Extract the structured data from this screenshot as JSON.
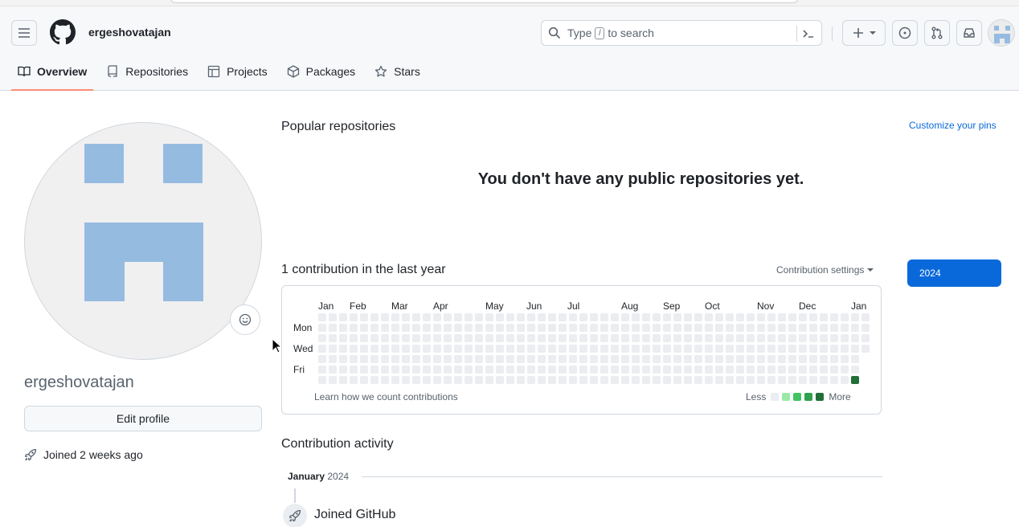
{
  "header": {
    "username": "ergeshovatajan",
    "search_placeholder_before": "Type",
    "search_slash": "/",
    "search_placeholder_after": "to search"
  },
  "tabs": [
    {
      "label": "Overview",
      "icon": "book-icon",
      "active": true
    },
    {
      "label": "Repositories",
      "icon": "repo-icon"
    },
    {
      "label": "Projects",
      "icon": "table-icon"
    },
    {
      "label": "Packages",
      "icon": "package-icon"
    },
    {
      "label": "Stars",
      "icon": "star-icon"
    }
  ],
  "profile": {
    "name": "ergeshovatajan",
    "edit_label": "Edit profile",
    "joined": "Joined 2 weeks ago"
  },
  "pinned": {
    "title": "Popular repositories",
    "customize": "Customize your pins",
    "empty": "You don't have any public repositories yet."
  },
  "contributions": {
    "title": "1 contribution in the last year",
    "settings": "Contribution settings",
    "year": "2024",
    "months": [
      "Jan",
      "Feb",
      "Mar",
      "Apr",
      "May",
      "Jun",
      "Jul",
      "Aug",
      "Sep",
      "Oct",
      "Nov",
      "Dec",
      "Jan"
    ],
    "days": [
      "Mon",
      "Wed",
      "Fri"
    ],
    "learn": "Learn how we count contributions",
    "less": "Less",
    "more": "More",
    "colors": [
      "#ebedf0",
      "#9be9a8",
      "#40c463",
      "#30a14e",
      "#216e39"
    ]
  },
  "activity": {
    "title": "Contribution activity",
    "month": "January",
    "year": "2024",
    "item": "Joined GitHub"
  }
}
